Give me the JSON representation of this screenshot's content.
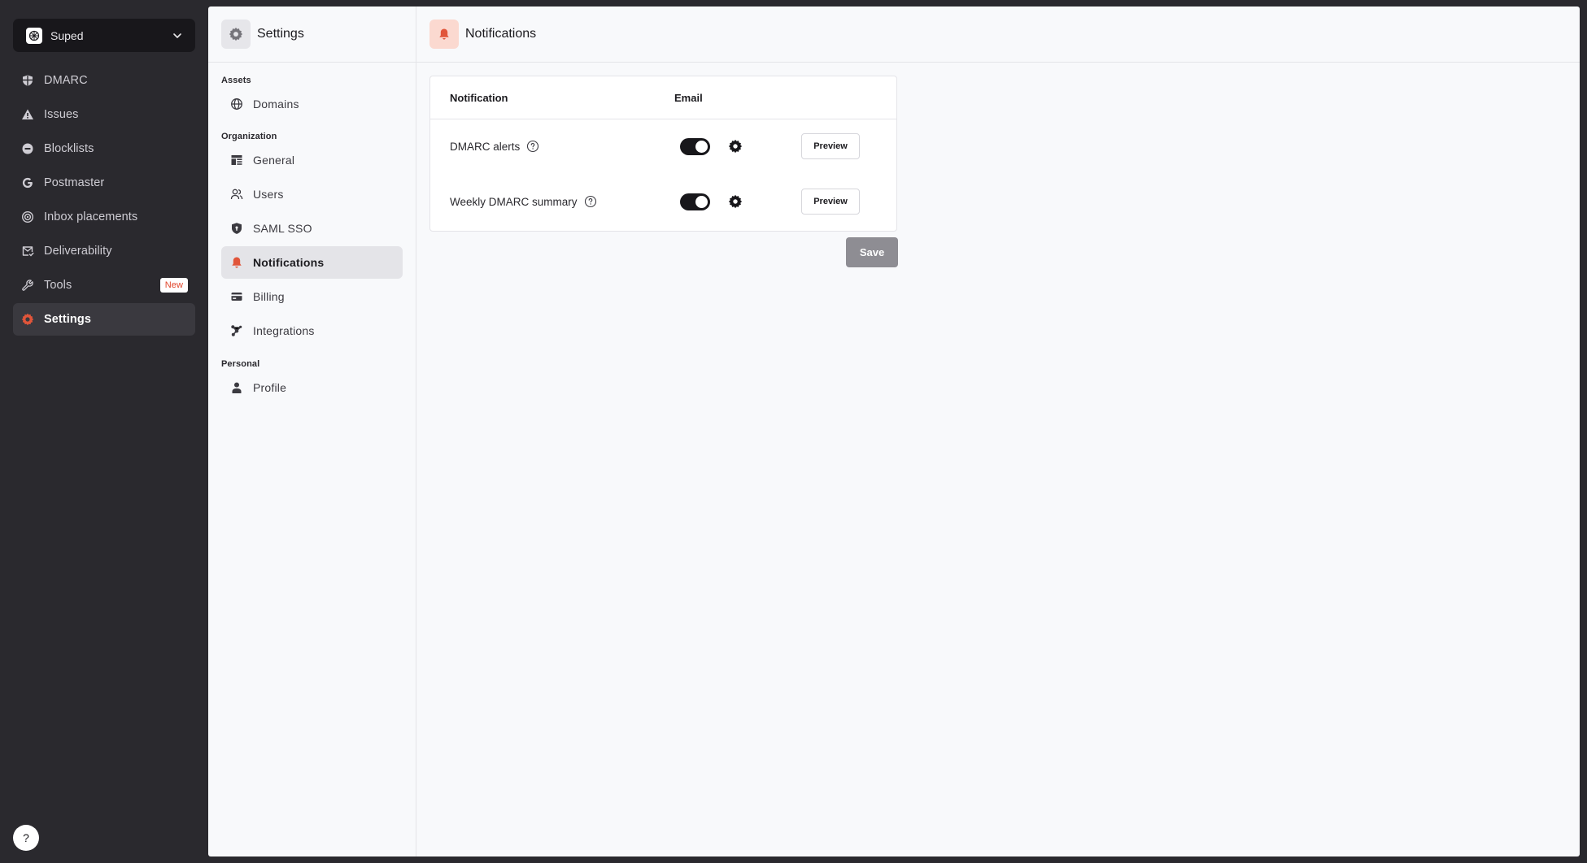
{
  "workspace": {
    "name": "Suped"
  },
  "nav": {
    "items": [
      {
        "label": "DMARC",
        "icon": "shield-icon"
      },
      {
        "label": "Issues",
        "icon": "warning-triangle-icon"
      },
      {
        "label": "Blocklists",
        "icon": "blocklist-icon"
      },
      {
        "label": "Postmaster",
        "icon": "google-g-icon"
      },
      {
        "label": "Inbox placements",
        "icon": "target-icon"
      },
      {
        "label": "Deliverability",
        "icon": "mail-check-icon"
      },
      {
        "label": "Tools",
        "icon": "wrench-icon",
        "badge": "New"
      },
      {
        "label": "Settings",
        "icon": "gear-icon",
        "active": true
      }
    ],
    "help_label": "?"
  },
  "settings": {
    "title": "Settings",
    "sections": [
      {
        "label": "Assets",
        "items": [
          {
            "label": "Domains",
            "icon": "globe-icon"
          }
        ]
      },
      {
        "label": "Organization",
        "items": [
          {
            "label": "General",
            "icon": "layout-icon"
          },
          {
            "label": "Users",
            "icon": "users-icon"
          },
          {
            "label": "SAML SSO",
            "icon": "shield-lock-icon"
          },
          {
            "label": "Notifications",
            "icon": "bell-icon",
            "active": true
          },
          {
            "label": "Billing",
            "icon": "credit-card-icon"
          },
          {
            "label": "Integrations",
            "icon": "integrations-icon"
          }
        ]
      },
      {
        "label": "Personal",
        "items": [
          {
            "label": "Profile",
            "icon": "person-icon"
          }
        ]
      }
    ]
  },
  "page": {
    "title": "Notifications",
    "table": {
      "headers": {
        "notification": "Notification",
        "email": "Email"
      },
      "rows": [
        {
          "name": "DMARC alerts",
          "email_enabled": true,
          "preview_label": "Preview"
        },
        {
          "name": "Weekly DMARC summary",
          "email_enabled": true,
          "preview_label": "Preview"
        }
      ]
    },
    "save_label": "Save"
  },
  "colors": {
    "accent": "#e1553a",
    "sidebar_bg": "#2a292e",
    "panel_bg": "#f8f9fb",
    "toggle_on": "#18171b",
    "save_disabled": "#8e8d93"
  }
}
